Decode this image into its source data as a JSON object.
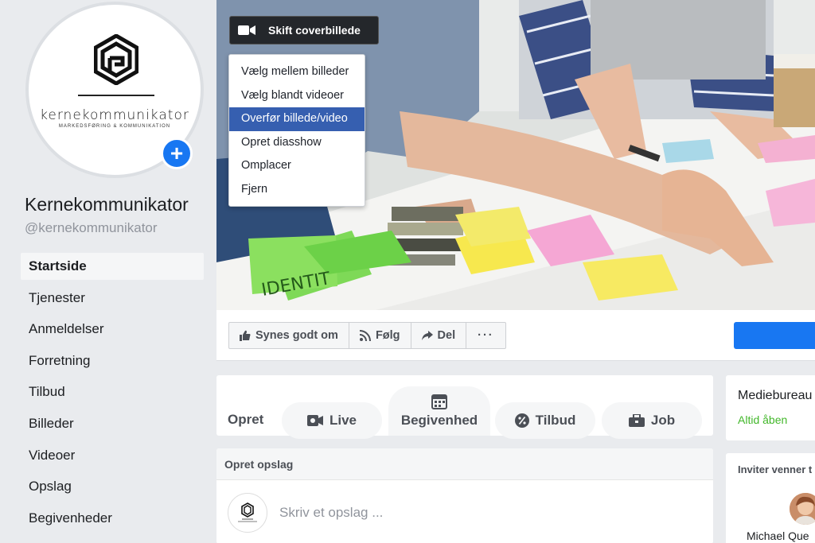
{
  "profile": {
    "logo_text": "kernekommunikator",
    "logo_tagline": "MARKEDSFØRING & KOMMUNIKATION",
    "page_name": "Kernekommunikator",
    "handle": "@kernekommunikator",
    "add_icon": "plus-icon"
  },
  "nav": {
    "items": [
      "Startside",
      "Tjenester",
      "Anmeldelser",
      "Forretning",
      "Tilbud",
      "Billeder",
      "Videoer",
      "Opslag",
      "Begivenheder"
    ],
    "active_index": 0
  },
  "cover": {
    "change_button": "Skift coverbillede",
    "change_icon": "video-camera-icon",
    "menu": [
      "Vælg mellem billeder",
      "Vælg blandt videoer",
      "Overfør billede/video",
      "Opret diasshow",
      "Omplacer",
      "Fjern"
    ],
    "highlight_index": 2,
    "sticky_note_text": "IDENTIT"
  },
  "actions": {
    "like": "Synes godt om",
    "follow": "Følg",
    "share": "Del",
    "more": "···"
  },
  "create": {
    "label": "Opret",
    "live": "Live",
    "event": "Begivenhed",
    "offer": "Tilbud",
    "job": "Job"
  },
  "composer": {
    "header": "Opret opslag",
    "placeholder": "Skriv et opslag ..."
  },
  "sidebar_right": {
    "category": "Mediebureau",
    "status": "Altid åben",
    "invite_title": "Inviter venner t",
    "friend_name": "Michael Que"
  },
  "colors": {
    "brand_blue": "#1877f2",
    "menu_highlight": "#365fb0",
    "open_green": "#42b72a"
  }
}
